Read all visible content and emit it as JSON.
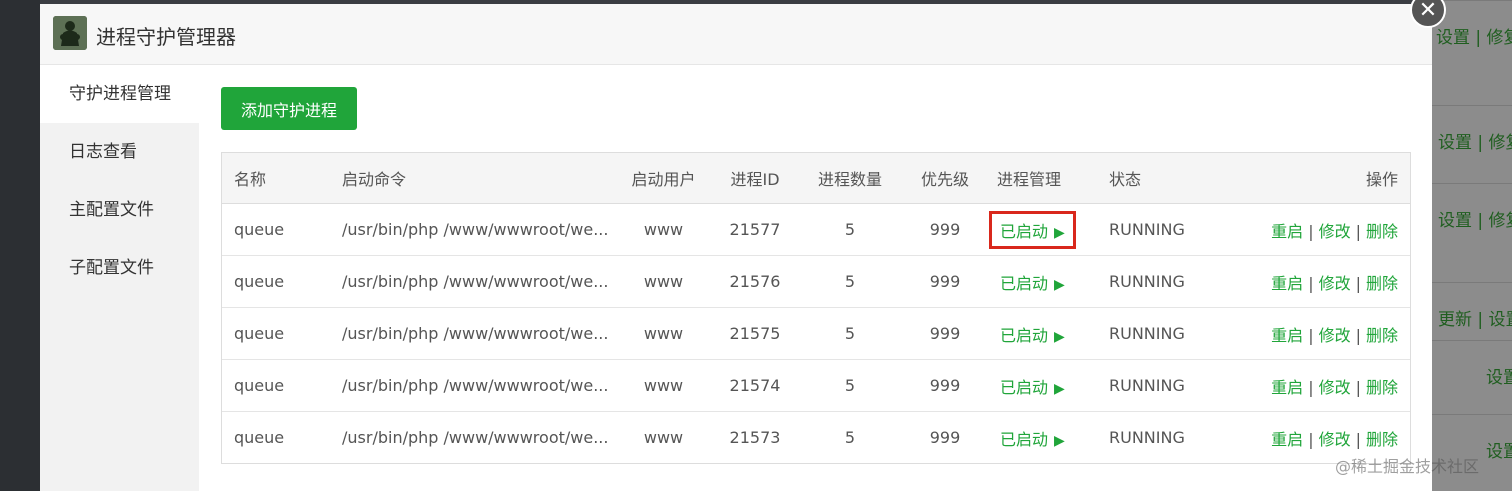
{
  "modal": {
    "title": "进程守护管理器",
    "close_glyph": "✕"
  },
  "sidebar": {
    "items": [
      {
        "label": "守护进程管理",
        "active": true
      },
      {
        "label": "日志查看"
      },
      {
        "label": "主配置文件"
      },
      {
        "label": "子配置文件"
      }
    ]
  },
  "toolbar": {
    "add_label": "添加守护进程"
  },
  "table": {
    "columns": [
      "名称",
      "启动命令",
      "启动用户",
      "进程ID",
      "进程数量",
      "优先级",
      "进程管理",
      "状态",
      "操作"
    ],
    "rows": [
      {
        "name": "queue",
        "command": "/usr/bin/php /www/wwwroot/we...",
        "user": "www",
        "pid": "21577",
        "count": "5",
        "priority": "999",
        "manage": "已启动",
        "status": "RUNNING"
      },
      {
        "name": "queue",
        "command": "/usr/bin/php /www/wwwroot/we...",
        "user": "www",
        "pid": "21576",
        "count": "5",
        "priority": "999",
        "manage": "已启动",
        "status": "RUNNING"
      },
      {
        "name": "queue",
        "command": "/usr/bin/php /www/wwwroot/we...",
        "user": "www",
        "pid": "21575",
        "count": "5",
        "priority": "999",
        "manage": "已启动",
        "status": "RUNNING"
      },
      {
        "name": "queue",
        "command": "/usr/bin/php /www/wwwroot/we...",
        "user": "www",
        "pid": "21574",
        "count": "5",
        "priority": "999",
        "manage": "已启动",
        "status": "RUNNING"
      },
      {
        "name": "queue",
        "command": "/usr/bin/php /www/wwwroot/we...",
        "user": "www",
        "pid": "21573",
        "count": "5",
        "priority": "999",
        "manage": "已启动",
        "status": "RUNNING"
      }
    ],
    "ops": {
      "restart": "重启",
      "edit": "修改",
      "delete": "删除",
      "separator": "|"
    },
    "play_glyph": "▶"
  },
  "background": {
    "rows": [
      "设置 | 修复",
      "设置 | 修复",
      "设置 | 修复",
      "更新 | 设置",
      "设置",
      "设置"
    ]
  },
  "watermark": "@稀土掘金技术社区",
  "colors": {
    "accent": "#20a53a",
    "highlight": "#d9281c"
  }
}
